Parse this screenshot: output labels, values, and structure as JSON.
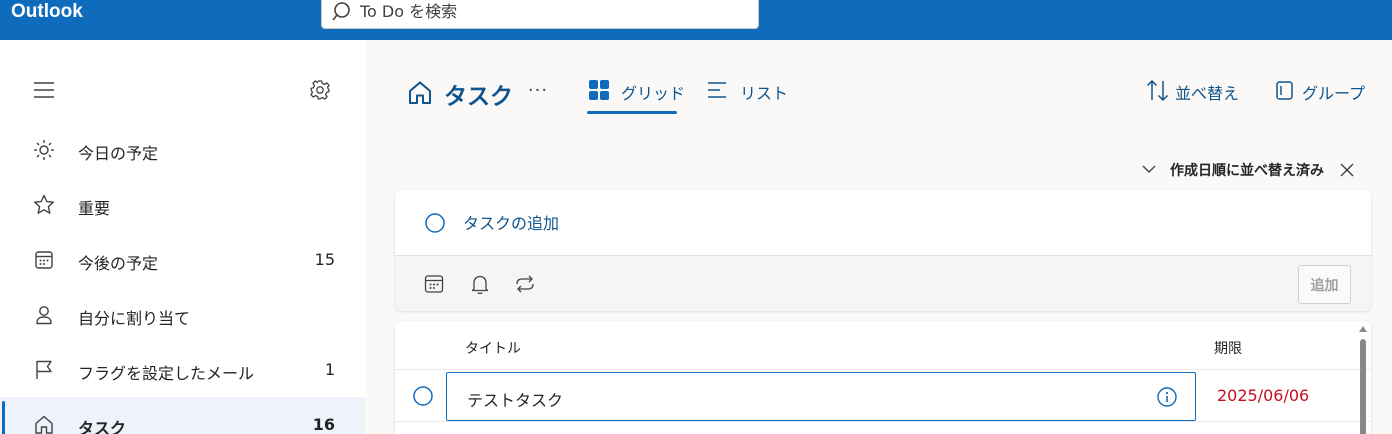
{
  "app": {
    "title": "Outlook"
  },
  "search": {
    "placeholder": "To Do を検索",
    "icon": "search-icon"
  },
  "sidebar": {
    "menu_icon": "hamburger-icon",
    "settings_icon": "gear-icon",
    "items": [
      {
        "label": "今日の予定",
        "count": "",
        "icon": "sun-icon"
      },
      {
        "label": "重要",
        "count": "",
        "icon": "star-icon"
      },
      {
        "label": "今後の予定",
        "count": "15",
        "icon": "calendar-icon"
      },
      {
        "label": "自分に割り当て",
        "count": "",
        "icon": "person-icon"
      },
      {
        "label": "フラグを設定したメール",
        "count": "1",
        "icon": "flag-icon"
      },
      {
        "label": "タスク",
        "count": "16",
        "icon": "home-icon",
        "active": true
      }
    ]
  },
  "header": {
    "title": "タスク",
    "more": "···",
    "tabs": [
      {
        "label": "グリッド",
        "icon": "grid-icon",
        "active": true
      },
      {
        "label": "リスト",
        "icon": "list-icon",
        "active": false
      }
    ],
    "sort_label": "並べ替え",
    "group_label": "グループ",
    "sort_status": "作成日順に並べ替え済み"
  },
  "add_task": {
    "placeholder": "タスクの追加",
    "button_label": "追加"
  },
  "task_list": {
    "columns": {
      "title": "タイトル",
      "due": "期限"
    },
    "rows": [
      {
        "title": "テストタスク",
        "due": "2025/06/06"
      }
    ]
  },
  "colors": {
    "accent": "#0f6cbd",
    "accent_text": "#0f548c",
    "overdue": "#c50f1f"
  }
}
